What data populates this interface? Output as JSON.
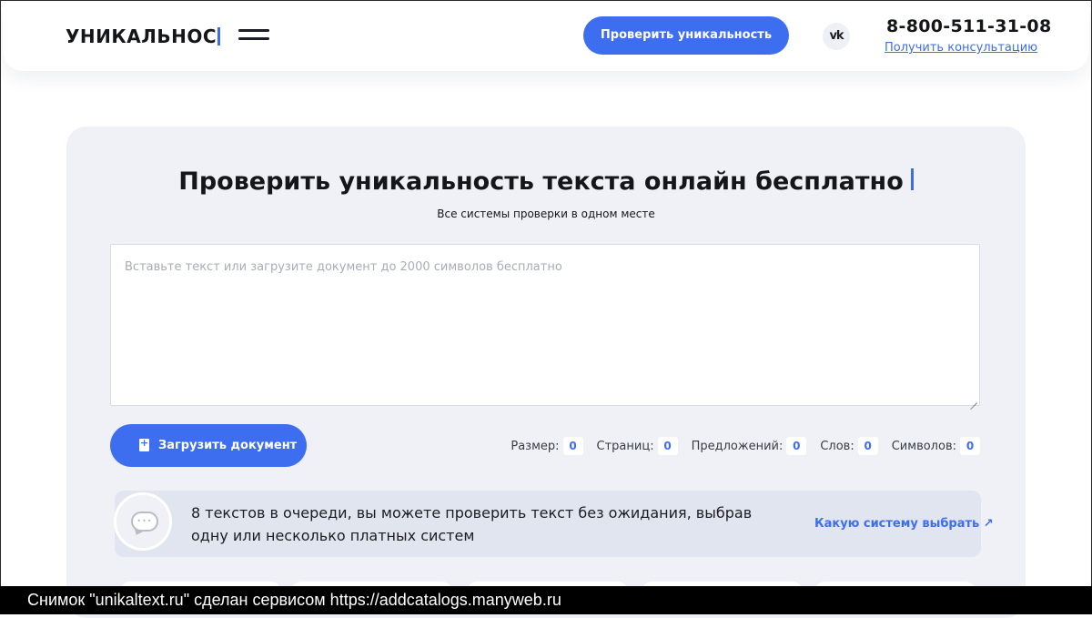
{
  "header": {
    "logo_text": "УНИКАЛЬНОС",
    "cta_label": "Проверить уникальность",
    "vk_label": "vk",
    "phone": "8-800-511-31-08",
    "consult_link": "Получить консультацию"
  },
  "main": {
    "title": "Проверить уникальность текста онлайн бесплатно",
    "subtitle": "Все системы проверки в одном месте",
    "textarea_placeholder": "Вставьте текст или загрузите документ до 2000 символов бесплатно",
    "upload_label": "Загрузить документ",
    "stats": [
      {
        "label": "Размер:",
        "value": "0"
      },
      {
        "label": "Страниц:",
        "value": "0"
      },
      {
        "label": "Предложений:",
        "value": "0"
      },
      {
        "label": "Слов:",
        "value": "0"
      },
      {
        "label": "Символов:",
        "value": "0"
      }
    ],
    "queue_text": "8 текстов в очереди, вы можете проверить текст без ожидания, выбрав одну или несколько платных систем",
    "queue_link": "Какую систему выбрать ↗"
  },
  "footer": {
    "caption": "Снимок \"unikaltext.ru\" сделан сервисом https://addcatalogs.manyweb.ru"
  },
  "colors": {
    "accent": "#3e6ef0",
    "card_bg": "#eff1f7",
    "queue_bg": "#e1e5ef"
  },
  "icons": [
    "hamburger-menu-icon",
    "vk-icon",
    "document-upload-icon",
    "chat-bubble-icon",
    "external-arrow-icon",
    "resize-handle-icon"
  ]
}
